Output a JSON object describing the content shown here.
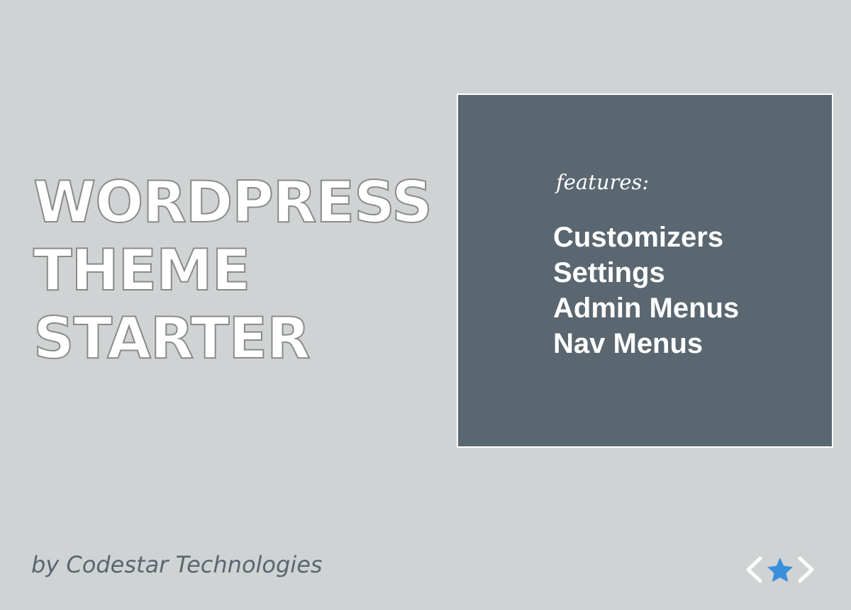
{
  "colors": {
    "background": "#d0d3d4",
    "card": "#5a6670",
    "title_fill": "#ffffff",
    "title_outline": "#8a8a8a",
    "byline_text": "#5a6670",
    "logo_chevrons": "#ffffff",
    "logo_star": "#3a8fdb"
  },
  "hero": {
    "title_lines": [
      "WORDPRESS",
      "THEME",
      "STARTER"
    ]
  },
  "features": {
    "label": "features:",
    "items": [
      "Customizers",
      "Settings",
      "Admin Menus",
      "Nav Menus"
    ]
  },
  "footer": {
    "byline": "by Codestar Technologies",
    "logo_icon": "chevron-star-logo"
  }
}
